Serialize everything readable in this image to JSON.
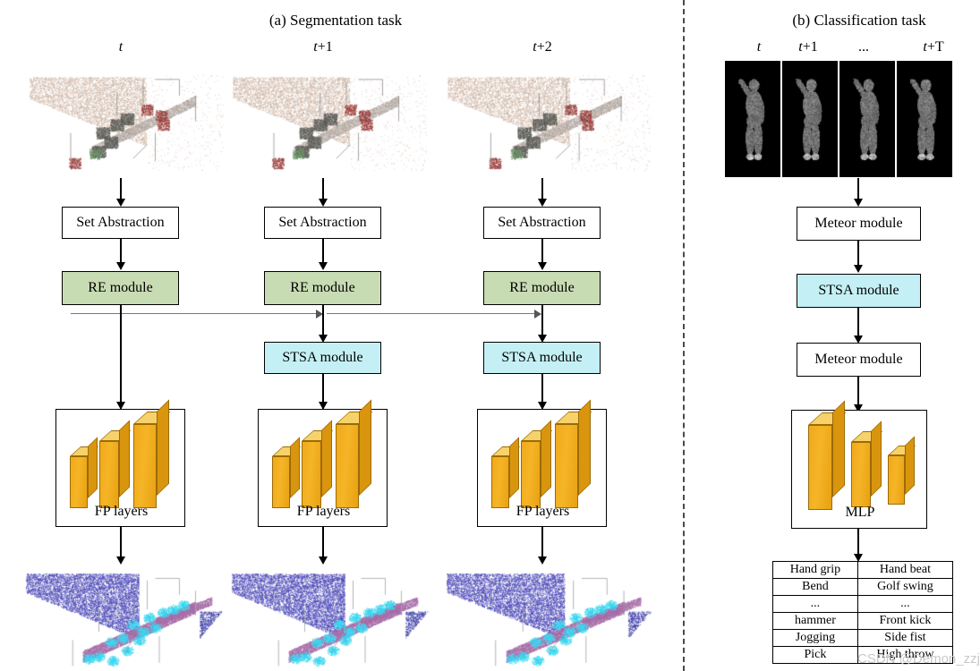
{
  "figure": {
    "panel_a_title": "(a) Segmentation task",
    "panel_b_title": "(b) Classification task",
    "watermark": "CSDN @Demon_zzj"
  },
  "segmentation": {
    "time_labels": [
      {
        "base": "t",
        "suffix": ""
      },
      {
        "base": "t",
        "suffix": "+1"
      },
      {
        "base": "t",
        "suffix": "+2"
      }
    ],
    "stage_labels": {
      "set_abstraction": "Set Abstraction",
      "re_module": "RE module",
      "stsa_module": "STSA module",
      "fp_layers": "FP layers"
    },
    "columns": [
      {
        "time": "t",
        "has_set_abstraction": true,
        "has_re_module": true,
        "has_stsa_module": false,
        "has_fp_layers": true
      },
      {
        "time": "t+1",
        "has_set_abstraction": true,
        "has_re_module": true,
        "has_stsa_module": true,
        "has_fp_layers": true
      },
      {
        "time": "t+2",
        "has_set_abstraction": true,
        "has_re_module": true,
        "has_stsa_module": true,
        "has_fp_layers": true
      }
    ]
  },
  "classification": {
    "time_labels": [
      {
        "base": "t",
        "suffix": ""
      },
      {
        "base": "t",
        "suffix": "+1"
      },
      {
        "base": "",
        "suffix": "..."
      },
      {
        "base": "t",
        "suffix": "+T"
      }
    ],
    "stage_labels": {
      "meteor_module_1": "Meteor module",
      "stsa_module": "STSA module",
      "meteor_module_2": "Meteor module",
      "mlp": "MLP"
    },
    "class_table": {
      "rows": [
        [
          "Hand grip",
          "Hand beat"
        ],
        [
          "Bend",
          "Golf swing"
        ],
        [
          "...",
          "..."
        ],
        [
          "hammer",
          "Front kick"
        ],
        [
          "Jogging",
          "Side fist"
        ],
        [
          "Pick",
          "High throw"
        ]
      ]
    }
  },
  "colors": {
    "re_module_fill": "#c8dcb4",
    "stsa_module_fill": "#c4f0f5",
    "box_stroke": "#000000",
    "slab_front": "#f5b526",
    "slab_top": "#f7d26a",
    "slab_side": "#d9950e",
    "cross_arrow": "#777777",
    "divider": "#4a4a4a"
  }
}
